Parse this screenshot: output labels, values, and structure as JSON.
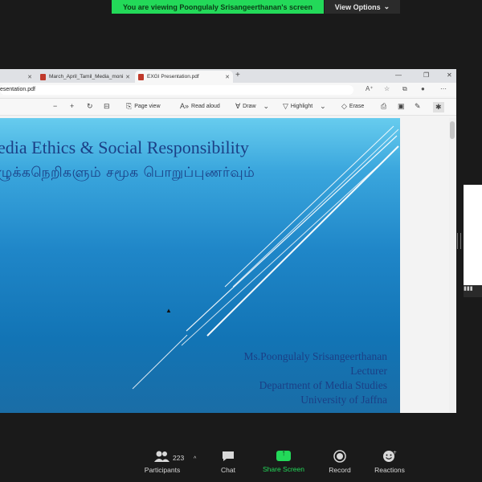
{
  "banner": {
    "text": "You are viewing Poongulaly Srisangeerthanan's screen",
    "view_options": "View Options"
  },
  "browser": {
    "tabs": [
      {
        "label": "",
        "active": false
      },
      {
        "label": "March_April_Tamil_Media_moni",
        "active": false
      },
      {
        "label": "EXGI Presentation.pdf",
        "active": true
      }
    ],
    "address": "esentation.pdf"
  },
  "pdf_toolbar": {
    "page_view": "Page view",
    "read_aloud": "Read aloud",
    "draw": "Draw",
    "highlight": "Highlight",
    "erase": "Erase"
  },
  "slide": {
    "title_en": "edia Ethics & Social Responsibility",
    "title_ta": "ழுக்கநெறிகளும் சமூக பொறுப்புணர்வும்",
    "presenter": "Ms.Poongulaly Srisangeerthanan",
    "role": "Lecturer",
    "department": "Department of Media Studies",
    "university": "University of Jaffna"
  },
  "meeting_controls": {
    "participants_label": "Participants",
    "participants_count": "223",
    "chat_label": "Chat",
    "share_label": "Share Screen",
    "record_label": "Record",
    "reactions_label": "Reactions"
  },
  "colors": {
    "zoom_green": "#23d959",
    "slide_title": "#1b3f86"
  },
  "icons": [
    "participants-icon",
    "chat-icon",
    "share-screen-icon",
    "record-icon",
    "reactions-icon"
  ]
}
